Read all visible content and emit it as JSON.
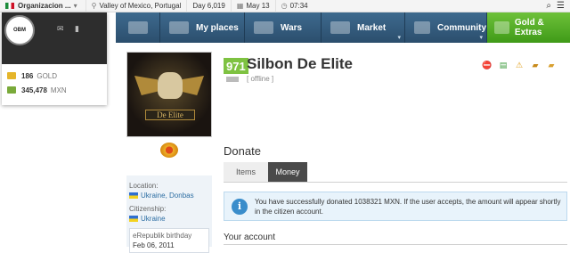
{
  "topbar": {
    "org_name": "Organizacion ...",
    "location": "Valley of Mexico, Portugal",
    "day": "Day 6,019",
    "date": "May 13",
    "time": "07:34"
  },
  "user_panel": {
    "avatar_text": "OBM",
    "gold_amount": "186",
    "gold_unit": "GOLD",
    "money_amount": "345,478",
    "money_unit": "MXN"
  },
  "nav": {
    "my_places": "My places",
    "wars": "Wars",
    "market": "Market",
    "community": "Community",
    "gold_extras": "Gold & Extras"
  },
  "profile": {
    "level": "971",
    "name": "Silbon De Elite",
    "status": "[ offline ]",
    "banner_text": "De Elite"
  },
  "sidebar": {
    "location_label": "Location:",
    "location_value": "Ukraine, Donbas",
    "citizenship_label": "Citizenship:",
    "citizenship_value": "Ukraine",
    "birthday_label": "eRepublik birthday",
    "birthday_value": "Feb 06, 2011"
  },
  "donate": {
    "title": "Donate",
    "tab_items": "Items",
    "tab_money": "Money",
    "notice": "You have successfully donated 1038321 MXN. If the user accepts, the amount will appear shortly in the citizen account.",
    "account_title": "Your account"
  },
  "colors": {
    "nav_blue": "#2b4e6d",
    "gold_green": "#3f9a18",
    "level_green": "#7ec241",
    "info_blue": "#3a8dcb"
  }
}
